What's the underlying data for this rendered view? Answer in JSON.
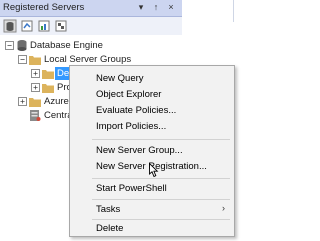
{
  "panel": {
    "title": "Registered Servers",
    "buttons": {
      "pin": "↑",
      "close": "×",
      "dropdown": "▾"
    }
  },
  "tree": {
    "root": {
      "label": "Database Engine",
      "expander": "−"
    },
    "group": {
      "label": "Local Server Groups",
      "expander": "−"
    },
    "child1": {
      "label": "Dev",
      "expander": "+"
    },
    "child2": {
      "label": "Pro",
      "expander": "+"
    },
    "azure": {
      "label": "Azure D",
      "expander": "+"
    },
    "central": {
      "label": "Central"
    }
  },
  "context_menu": {
    "items": [
      {
        "label": "New Query"
      },
      {
        "label": "Object Explorer"
      },
      {
        "label": "Evaluate Policies..."
      },
      {
        "label": "Import Policies..."
      },
      {
        "label": "New Server Group..."
      },
      {
        "label": "New Server Registration..."
      },
      {
        "label": "Start PowerShell"
      },
      {
        "label": "Tasks",
        "submenu_arrow": "›"
      },
      {
        "label": "Delete"
      }
    ]
  },
  "colors": {
    "titlebar": "#ccd5f0",
    "selection": "#3399ff",
    "menu_bg": "#f2f2f2",
    "folder": "#dcb35c"
  },
  "icons": [
    "database-icon",
    "folder-icon",
    "server-icon",
    "mouse-pointer-icon"
  ]
}
